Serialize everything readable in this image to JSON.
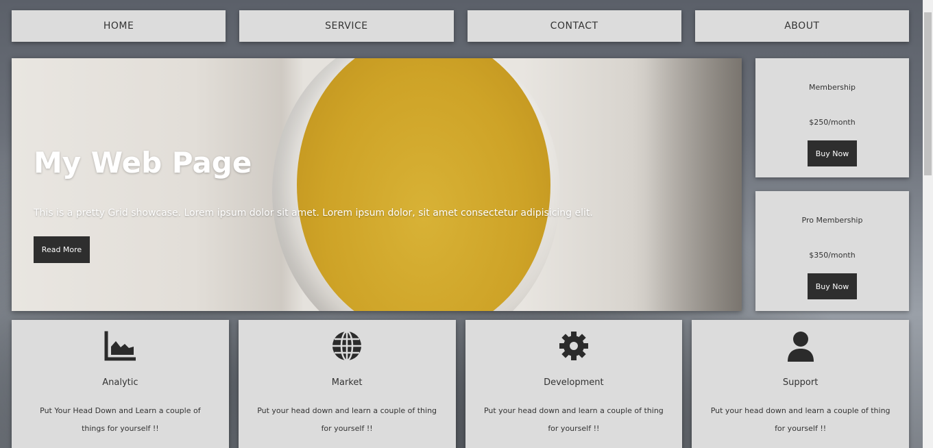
{
  "nav": {
    "items": [
      {
        "label": "HOME"
      },
      {
        "label": "SERVICE"
      },
      {
        "label": "CONTACT"
      },
      {
        "label": "ABOUT"
      }
    ]
  },
  "hero": {
    "title": "My Web Page",
    "text": "This is a pretty Grid showcase. Lorem ipsum dolor sit amet. Lorem ipsum dolor, sit amet consectetur adipisicing elit.",
    "button": "Read More"
  },
  "plans": [
    {
      "name": "Membership",
      "price": "$250/month",
      "button": "Buy Now"
    },
    {
      "name": "Pro Membership",
      "price": "$350/month",
      "button": "Buy Now"
    }
  ],
  "features": [
    {
      "icon": "chart-area-icon",
      "title": "Analytic",
      "text": "Put Your Head Down and Learn a couple of things for yourself !!"
    },
    {
      "icon": "globe-icon",
      "title": "Market",
      "text": "Put your head down and learn a couple of thing for yourself !!"
    },
    {
      "icon": "gear-icon",
      "title": "Development",
      "text": "Put your head down and learn a couple of thing for yourself !!"
    },
    {
      "icon": "user-icon",
      "title": "Support",
      "text": "Put your head down and learn a couple of thing for yourself !!"
    }
  ],
  "colors": {
    "card": "#dcdcdc",
    "button": "#2e2e2e",
    "icon": "#2b2b2b"
  }
}
